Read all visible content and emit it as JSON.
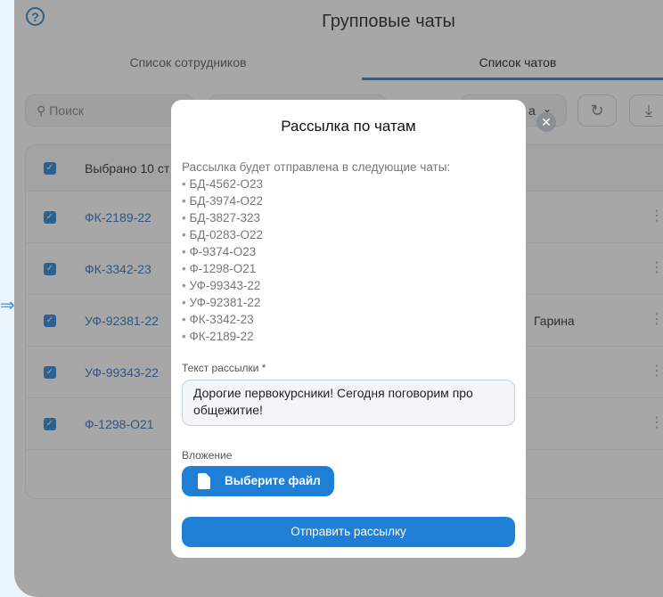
{
  "header": {
    "title": "Групповые чаты",
    "help_glyph": "?"
  },
  "tabs": [
    {
      "label": "Список сотрудников"
    },
    {
      "label": "Список чатов"
    }
  ],
  "toolbar": {
    "search_placeholder": "Поиск",
    "filter_partial": "а",
    "refresh_glyph": "↻",
    "download_glyph": "⤓"
  },
  "table": {
    "header_label": "Выбрано 10 ст",
    "rows": [
      {
        "code": "ФК-2189-22",
        "extra": ""
      },
      {
        "code": "ФК-3342-23",
        "extra": ""
      },
      {
        "code": "УФ-92381-22",
        "extra": "Гарина"
      },
      {
        "code": "УФ-99343-22",
        "extra": ""
      },
      {
        "code": "Ф-1298-О21",
        "extra": ""
      }
    ]
  },
  "modal": {
    "title": "Рассылка по чатам",
    "intro": "Рассылка будет отправлена в следующие чаты:",
    "chats": [
      "БД-4562-О23",
      "БД-3974-О22",
      "БД-3827-323",
      "БД-0283-О22",
      "Ф-9374-О23",
      "Ф-1298-О21",
      "УФ-99343-22",
      "УФ-92381-22",
      "ФК-3342-23",
      "ФК-2189-22"
    ],
    "text_label": "Текст рассылки *",
    "text_value": "Дорогие первокурсники! Сегодня поговорим про общежитие!",
    "attachment_label": "Вложение",
    "file_button": "Выберите файл",
    "send_button": "Отправить рассылку",
    "close_glyph": "✕"
  },
  "colors": {
    "accent": "#1f7fd6",
    "overlay": "rgba(60,60,60,0.45)"
  }
}
